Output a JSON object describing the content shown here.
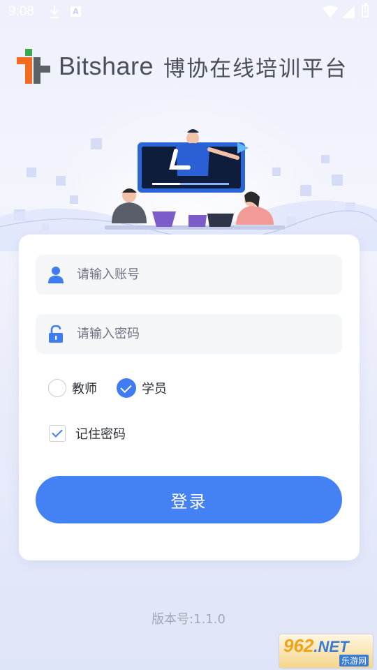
{
  "status_bar": {
    "time": "9:08"
  },
  "header": {
    "brand": "Bitshare",
    "brand_cn": "博协在线培训平台"
  },
  "login": {
    "account_placeholder": "请输入账号",
    "password_placeholder": "请输入密码",
    "roles": [
      {
        "label": "教师",
        "selected": false
      },
      {
        "label": "学员",
        "selected": true
      }
    ],
    "remember_label": "记住密码",
    "remember_checked": true,
    "submit_label": "登录"
  },
  "footer": {
    "version": "版本号:1.1.0"
  },
  "watermark": {
    "text": "962.NET",
    "subtext": "乐游网"
  },
  "colors": {
    "accent": "#4381f5",
    "logo_orange": "#f26b21",
    "logo_gray": "#5b5f66",
    "logo_green": "#3aa84c"
  }
}
